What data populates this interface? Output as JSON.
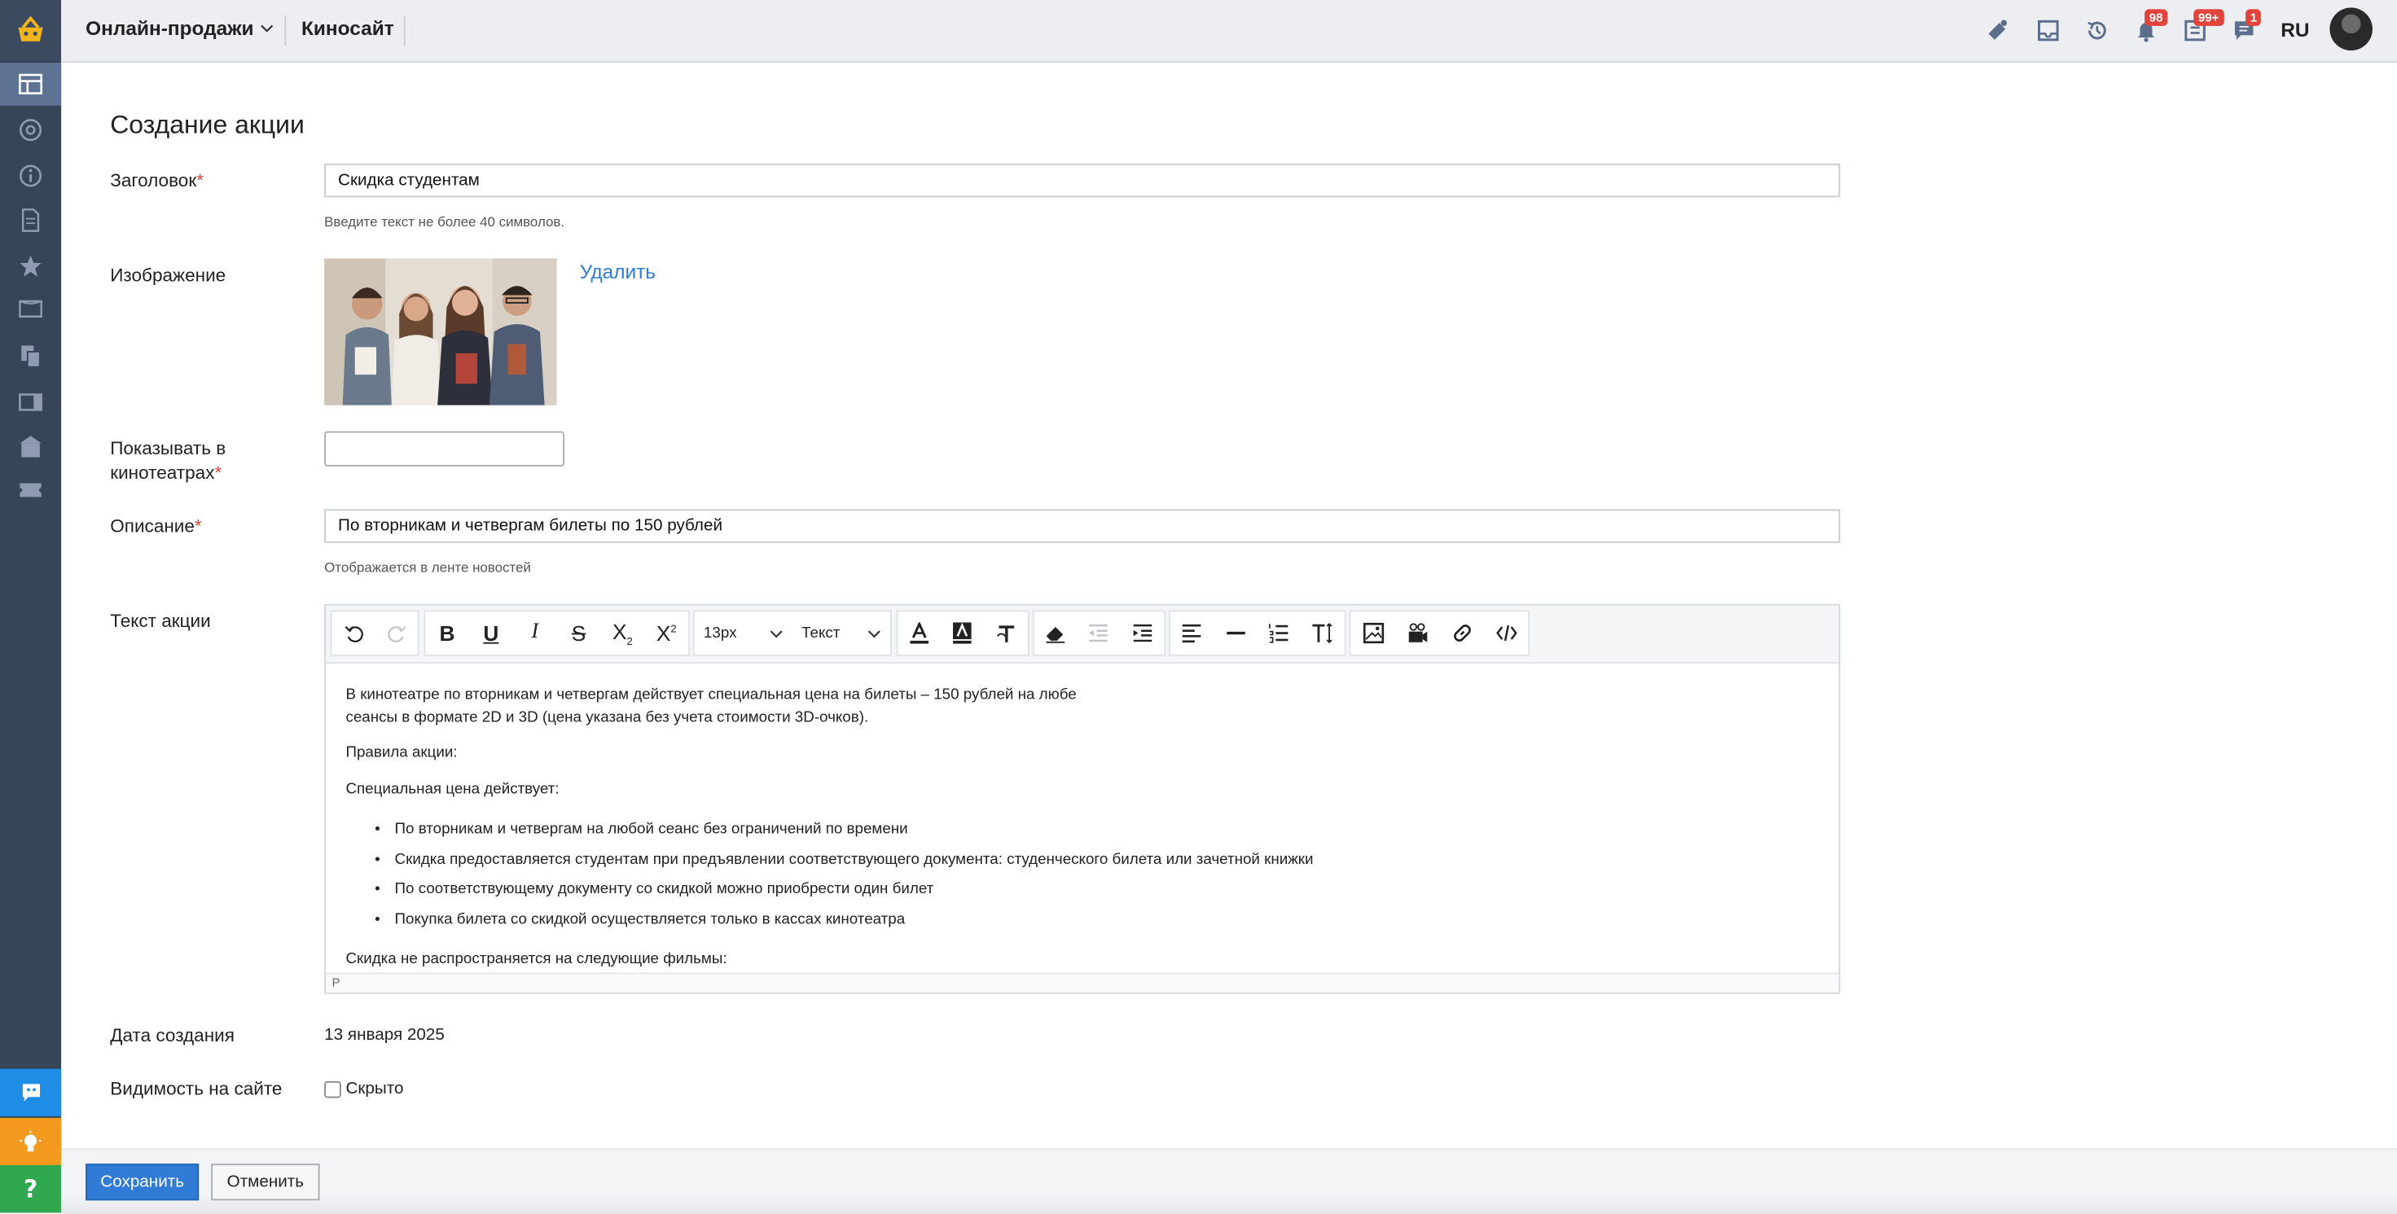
{
  "header": {
    "app_name": "Онлайн-продажи",
    "site_name": "Киносайт",
    "notifications_badge": "98",
    "tasks_badge": "99+",
    "messages_badge": "1",
    "language": "RU"
  },
  "sidebar": {
    "items": [
      "dashboard-icon",
      "at-icon",
      "info-icon",
      "document-icon",
      "star-icon",
      "ticket-frame-icon",
      "copy-icon",
      "panel-icon",
      "building-icon",
      "ticket-icon"
    ],
    "bottom": [
      "chat-icon",
      "lightbulb-icon",
      "help-icon"
    ]
  },
  "form": {
    "page_title": "Создание акции",
    "title_label": "Заголовок",
    "title_value": "Скидка студентам",
    "title_hint": "Введите текст не более 40 символов.",
    "image_label": "Изображение",
    "delete_link": "Удалить",
    "cinemas_label_line1": "Показывать в",
    "cinemas_label_line2": "кинотеатрах",
    "description_label": "Описание",
    "description_value": "По вторникам и четвергам билеты по 150 рублей",
    "description_hint": "Отображается в ленте новостей",
    "body_label": "Текст акции",
    "created_label": "Дата создания",
    "created_value": "13 января 2025",
    "visibility_label": "Видимость на сайте",
    "visibility_option": "Скрыто",
    "required_mark": "*"
  },
  "editor": {
    "font_size": "13px",
    "block_format": "Текст",
    "para1_line1": "В кинотеатре по вторникам и четвергам действует специальная цена на билеты – 150 рублей на любе",
    "para1_line2": "сеансы в формате 2D и 3D (цена указана без учета стоимости 3D-очков).",
    "para2": "Правила акции:",
    "para3": "Специальная цена действует:",
    "bullets": [
      "По вторникам и четвергам на любой сеанс без ограничений по времени",
      "Скидка предоставляется студентам при предъявлении соответствующего документа: студенческого билета или зачетной книжки",
      "По соответствующему документу со скидкой можно приобрести один билет",
      "Покупка билета со скидкой осуществляется только в кассах кинотеатра"
    ],
    "para4": "Скидка не распространяется на следующие фильмы:",
    "status_path": "P"
  },
  "footer": {
    "save_label": "Сохранить",
    "cancel_label": "Отменить"
  },
  "colors": {
    "sidebar_bg": "#374559",
    "sidebar_active": "#5e7393",
    "accent_blue": "#2f7bd6",
    "badge_red": "#e2443c",
    "chat_blue": "#1f8ce6",
    "idea_orange": "#f39a1e",
    "help_green": "#2fa84f"
  }
}
